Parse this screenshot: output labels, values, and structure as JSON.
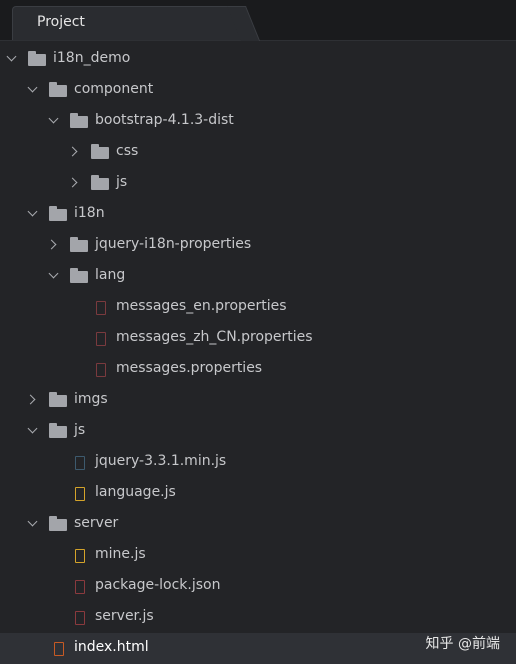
{
  "tab": {
    "label": "Project"
  },
  "tree": {
    "i18n_demo": "i18n_demo",
    "component": "component",
    "bootstrap": "bootstrap-4.1.3-dist",
    "css": "css",
    "js_bootstrap": "js",
    "i18n": "i18n",
    "jquery_i18n": "jquery-i18n-properties",
    "lang": "lang",
    "messages_en": "messages_en.properties",
    "messages_zh": "messages_zh_CN.properties",
    "messages": "messages.properties",
    "imgs": "imgs",
    "js": "js",
    "jquery_min": "jquery-3.3.1.min.js",
    "language_js": "language.js",
    "server": "server",
    "mine_js": "mine.js",
    "package_lock": "package-lock.json",
    "server_js": "server.js",
    "index_html": "index.html"
  },
  "watermark": "知乎 @前端"
}
